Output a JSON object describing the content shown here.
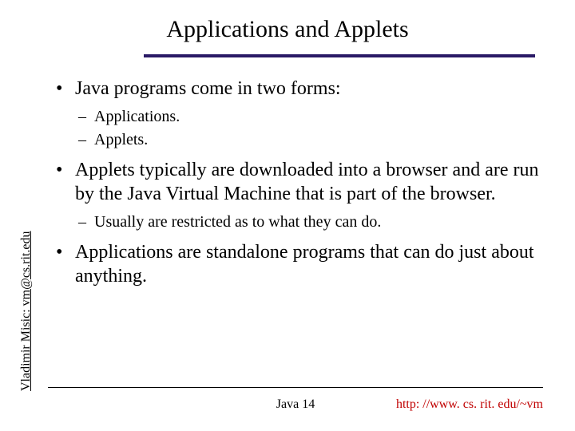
{
  "title": "Applications and Applets",
  "sidebar": {
    "text": "Vladimir Misic: vm@cs.rit.edu"
  },
  "bullets": {
    "b1": "Java programs come in two forms:",
    "b1a": "Applications.",
    "b1b": "Applets.",
    "b2": "Applets typically are downloaded into a browser and are run by the Java Virtual Machine that is part of the browser.",
    "b2a": "Usually are restricted as to what they can do.",
    "b3": "Applications are standalone programs that can do just about anything."
  },
  "footer": {
    "page": "Java 14",
    "url": "http: //www. cs. rit. edu/~vm"
  }
}
